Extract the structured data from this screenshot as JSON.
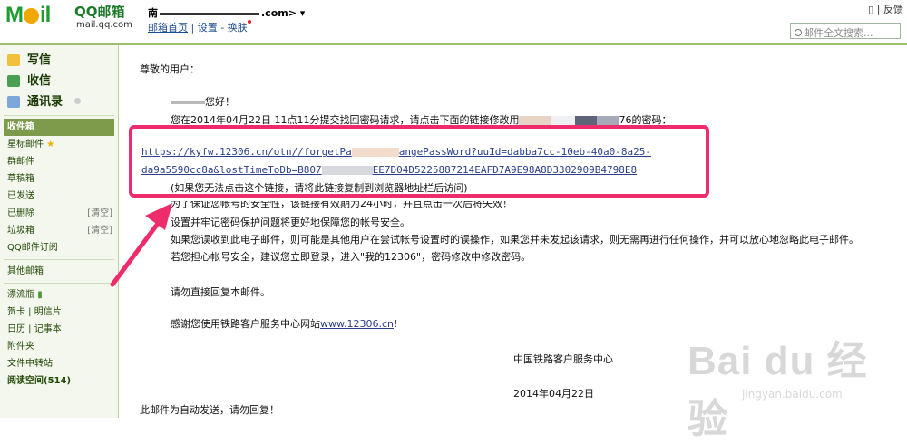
{
  "header": {
    "logo_text": "MOil",
    "brand": "QQ邮箱",
    "domain": "mail.qq.com",
    "user_prefix": "南",
    "user_suffix": ".com>",
    "links": {
      "home": "邮箱首页",
      "settings": "设置",
      "skin": "换肤"
    },
    "feedback": "反馈",
    "search_placeholder": "邮件全文搜索..."
  },
  "sidebar": {
    "write": "写信",
    "receive": "收信",
    "contacts": "通讯录",
    "folders": [
      {
        "label": "收件箱",
        "active": true
      },
      {
        "label": "星标邮件"
      },
      {
        "label": "群邮件"
      },
      {
        "label": "草稿箱"
      },
      {
        "label": "已发送"
      },
      {
        "label": "已删除",
        "action": "[清空]"
      },
      {
        "label": "垃圾箱",
        "action": "[清空]"
      },
      {
        "label": "QQ邮件订阅"
      }
    ],
    "other_mailbox": "其他邮箱",
    "apps": [
      {
        "label": "漂流瓶"
      },
      {
        "label": "贺卡  |  明信片"
      },
      {
        "label": "日历  |  记事本"
      },
      {
        "label": "附件夹"
      },
      {
        "label": "文件中转站"
      },
      {
        "label": "阅读空间(514)",
        "bold": true
      }
    ]
  },
  "email": {
    "salutation": "尊敬的用户：",
    "greeting": "您好！",
    "line_request_a": "您在2014年04月22日 11点11分提交找回密码请求，请点击下面的链接修改用",
    "line_request_b": "76的密码：",
    "link_line1_a": "https://kyfw.12306.cn/otn//forgetPa",
    "link_line1_b": "angePassWord?uuId=dabba7cc-10eb-40a0-8a25-",
    "link_line2_a": "da9a5590cc8a&lostTimeToDb=B807",
    "link_line2_b": "EE7D04D5225887214EAFD7A9E98A8D3302909B4798E8",
    "copy_hint": "(如果您无法点击这个链接，请将此链接复制到浏览器地址栏后访问)",
    "obscured": "为了保证您帐号的安全性，该链接有效期为24小时，并且点击一次后将失效！",
    "security_tip": "设置并牢记密码保护问题将更好地保障您的帐号安全。",
    "mistake_note": "如果您误收到此电子邮件，则可能是其他用户在尝试帐号设置时的误操作，如果您并未发起该请求，则无需再进行任何操作，并可以放心地忽略此电子邮件。",
    "worry_note": "若您担心帐号安全，建议您立即登录，进入\"我的12306\"，密码修改中修改密码。",
    "no_reply": "请勿直接回复本邮件。",
    "thanks_prefix": "感谢您使用铁路客户服务中心网站",
    "thanks_link": "www.12306.cn",
    "thanks_suffix": "!",
    "signature": "中国铁路客户服务中心",
    "date": "2014年04月22日",
    "auto_note": "此邮件为自动发送，请勿回复！"
  },
  "watermark": {
    "main": "Bai du 经验",
    "sub": "jingyan.baidu.com"
  },
  "colors": {
    "highlight": "#ee2c6b",
    "accent_green": "#7e9b4c",
    "link": "#2c3f8c"
  }
}
